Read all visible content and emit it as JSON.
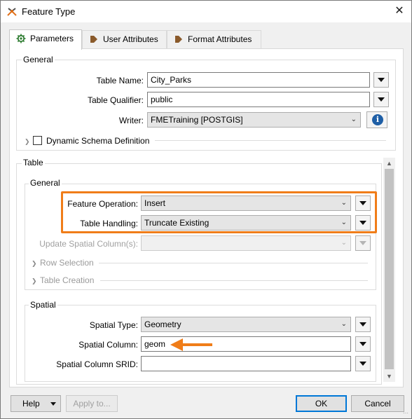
{
  "window": {
    "title": "Feature Type",
    "close": "✕"
  },
  "tabs": [
    {
      "label": "Parameters",
      "icon": "gear-icon"
    },
    {
      "label": "User Attributes",
      "icon": "arrow-right-icon"
    },
    {
      "label": "Format Attributes",
      "icon": "arrow-right-icon"
    }
  ],
  "general": {
    "title": "General",
    "table_name_label": "Table Name:",
    "table_name_value": "City_Parks",
    "table_qualifier_label": "Table Qualifier:",
    "table_qualifier_value": "public",
    "writer_label": "Writer:",
    "writer_value": "FMETraining [POSTGIS]",
    "dynamic_schema_label": "Dynamic Schema Definition",
    "dynamic_schema_checked": false
  },
  "table": {
    "title": "Table",
    "general_title": "General",
    "feature_operation_label": "Feature Operation:",
    "feature_operation_value": "Insert",
    "table_handling_label": "Table Handling:",
    "table_handling_value": "Truncate Existing",
    "update_spatial_label": "Update Spatial Column(s):",
    "update_spatial_value": "",
    "row_selection_label": "Row Selection",
    "table_creation_label": "Table Creation",
    "spatial_title": "Spatial",
    "spatial_type_label": "Spatial Type:",
    "spatial_type_value": "Geometry",
    "spatial_column_label": "Spatial Column:",
    "spatial_column_value": "geom",
    "spatial_srid_label": "Spatial Column SRID:",
    "spatial_srid_value": ""
  },
  "footer": {
    "help_label": "Help",
    "apply_label": "Apply to...",
    "ok_label": "OK",
    "cancel_label": "Cancel"
  },
  "colors": {
    "highlight": "#f07d19",
    "info": "#1f5fa6",
    "default_button": "#0078d7"
  }
}
